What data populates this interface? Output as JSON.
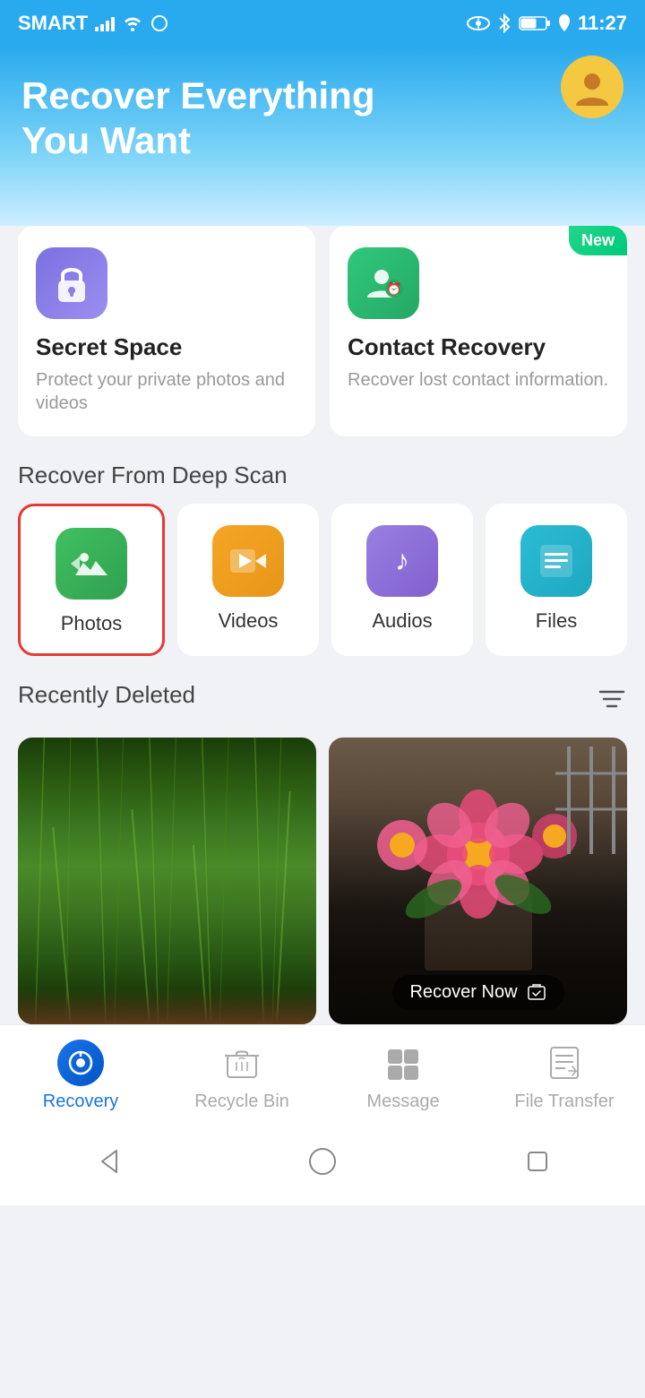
{
  "status_bar": {
    "carrier": "SMART",
    "time": "11:27",
    "battery": "52"
  },
  "header": {
    "title_line1": "Recover Everything",
    "title_line2": "You Want"
  },
  "top_cards": [
    {
      "id": "secret-space",
      "title": "Secret Space",
      "desc": "Protect your private photos and videos",
      "badge": null
    },
    {
      "id": "contact-recovery",
      "title": "Contact Recovery",
      "desc": "Recover lost contact information.",
      "badge": "New"
    }
  ],
  "deep_scan": {
    "section_label": "Recover From Deep Scan",
    "items": [
      {
        "id": "photos",
        "label": "Photos",
        "selected": true
      },
      {
        "id": "videos",
        "label": "Videos",
        "selected": false
      },
      {
        "id": "audios",
        "label": "Audios",
        "selected": false
      },
      {
        "id": "files",
        "label": "Files",
        "selected": false
      }
    ]
  },
  "recently_deleted": {
    "section_label": "Recently Deleted"
  },
  "photo_overlay": {
    "recover_now": "Recover Now"
  },
  "bottom_nav": {
    "items": [
      {
        "id": "recovery",
        "label": "Recovery",
        "active": true
      },
      {
        "id": "recycle-bin",
        "label": "Recycle Bin",
        "active": false
      },
      {
        "id": "message",
        "label": "Message",
        "active": false
      },
      {
        "id": "file-transfer",
        "label": "File Transfer",
        "active": false
      }
    ]
  }
}
